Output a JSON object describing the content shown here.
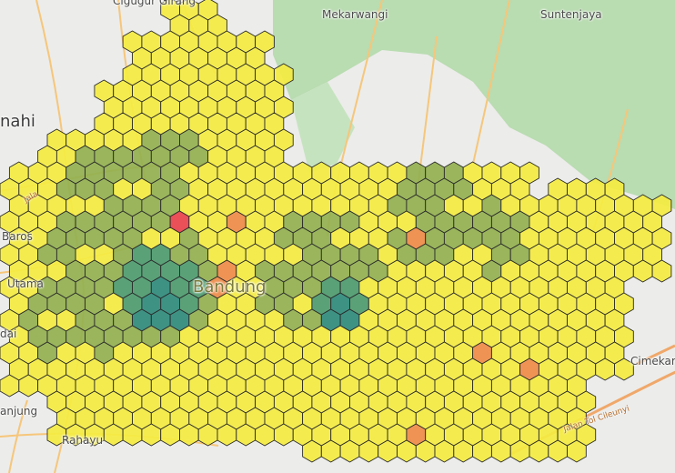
{
  "map": {
    "places": {
      "cigugur": "Cigugur Girang",
      "cimahi": "nahi",
      "mekarwangi": "Mekarwangi",
      "suntenjaya": "Suntenjaya",
      "baros": "Baros",
      "utama": "Utama",
      "bandung": "Bandung",
      "cimekar": "Cimekar",
      "anjung": "anjung",
      "rahayu": "Rahayu",
      "ada": "dai"
    },
    "roads": {
      "cileunyi": "Jalan Tol Cileunyi",
      "jala": "Jala"
    },
    "layers": {
      "basemap": "street-basemap",
      "overlay": "hexagon-density-grid"
    },
    "legend_colors": {
      "low": "#f4ec41",
      "medium": "#93b04f",
      "high_green": "#4d9a6e",
      "teal": "#2f8a7b",
      "orange_low": "#f1a55a",
      "orange": "#ee8b47",
      "red": "#e8424a",
      "park": "#b9dcb1"
    }
  }
}
